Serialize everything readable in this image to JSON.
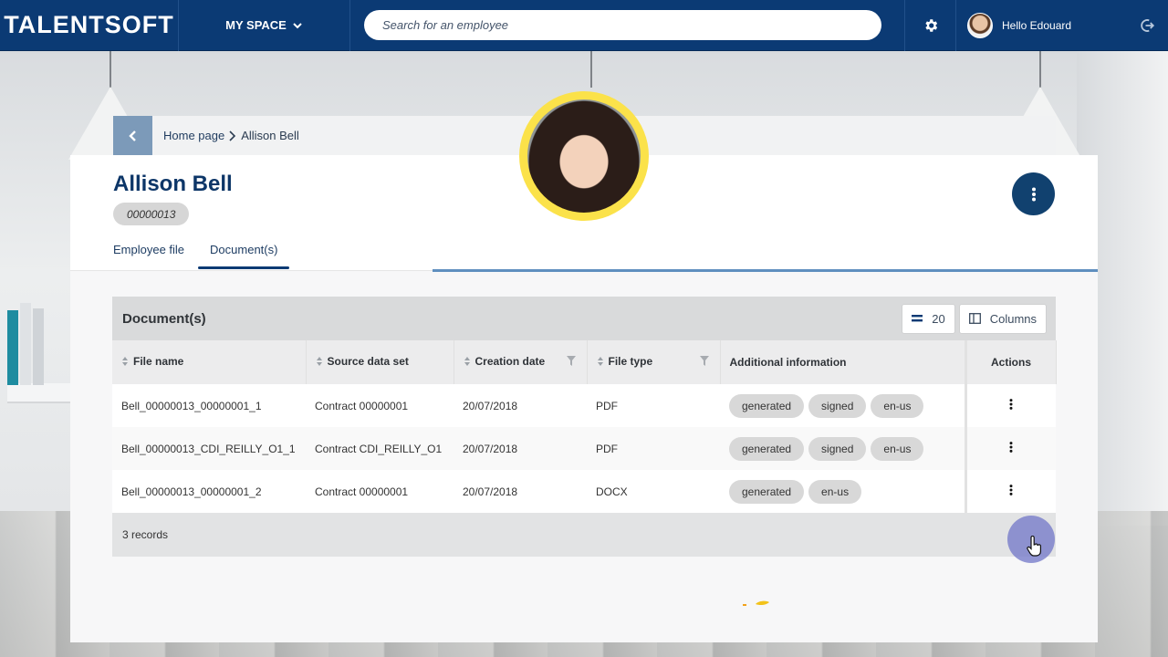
{
  "app": {
    "logo": "TALENTSOFT"
  },
  "nav": {
    "myspace_label": "MY SPACE",
    "search_placeholder": "Search for an employee",
    "greeting": "Hello Edouard"
  },
  "breadcrumb": {
    "home": "Home page",
    "separator": ">",
    "current": "Allison Bell"
  },
  "employee": {
    "name": "Allison Bell",
    "id": "00000013"
  },
  "tabs": [
    {
      "label": "Employee file",
      "active": false
    },
    {
      "label": "Document(s)",
      "active": true
    }
  ],
  "documents": {
    "title": "Document(s)",
    "page_size": "20",
    "columns_button": "Columns",
    "headers": [
      "File name",
      "Source data set",
      "Creation date",
      "File type",
      "Additional information",
      "Actions"
    ],
    "rows": [
      {
        "file_name": "Bell_00000013_00000001_1",
        "source": "Contract 00000001",
        "date": "20/07/2018",
        "type": "PDF",
        "tags": [
          "generated",
          "signed",
          "en-us"
        ]
      },
      {
        "file_name": "Bell_00000013_CDI_REILLY_O1_1",
        "source": "Contract CDI_REILLY_O1",
        "date": "20/07/2018",
        "type": "PDF",
        "tags": [
          "generated",
          "signed",
          "en-us"
        ]
      },
      {
        "file_name": "Bell_00000013_00000001_2",
        "source": "Contract 00000001",
        "date": "20/07/2018",
        "type": "DOCX",
        "tags": [
          "generated",
          "en-us"
        ]
      }
    ],
    "footer": "3 records"
  },
  "colors": {
    "topbar": "#0b3a74",
    "accent": "#5f8fbf",
    "photo_ring": "#fbe24a"
  },
  "icons": [
    "chevron-down-icon",
    "gear-icon",
    "logout-icon",
    "back-arrow-icon",
    "kebab-icon",
    "sort-icon",
    "filter-icon",
    "list-icon",
    "columns-icon"
  ]
}
